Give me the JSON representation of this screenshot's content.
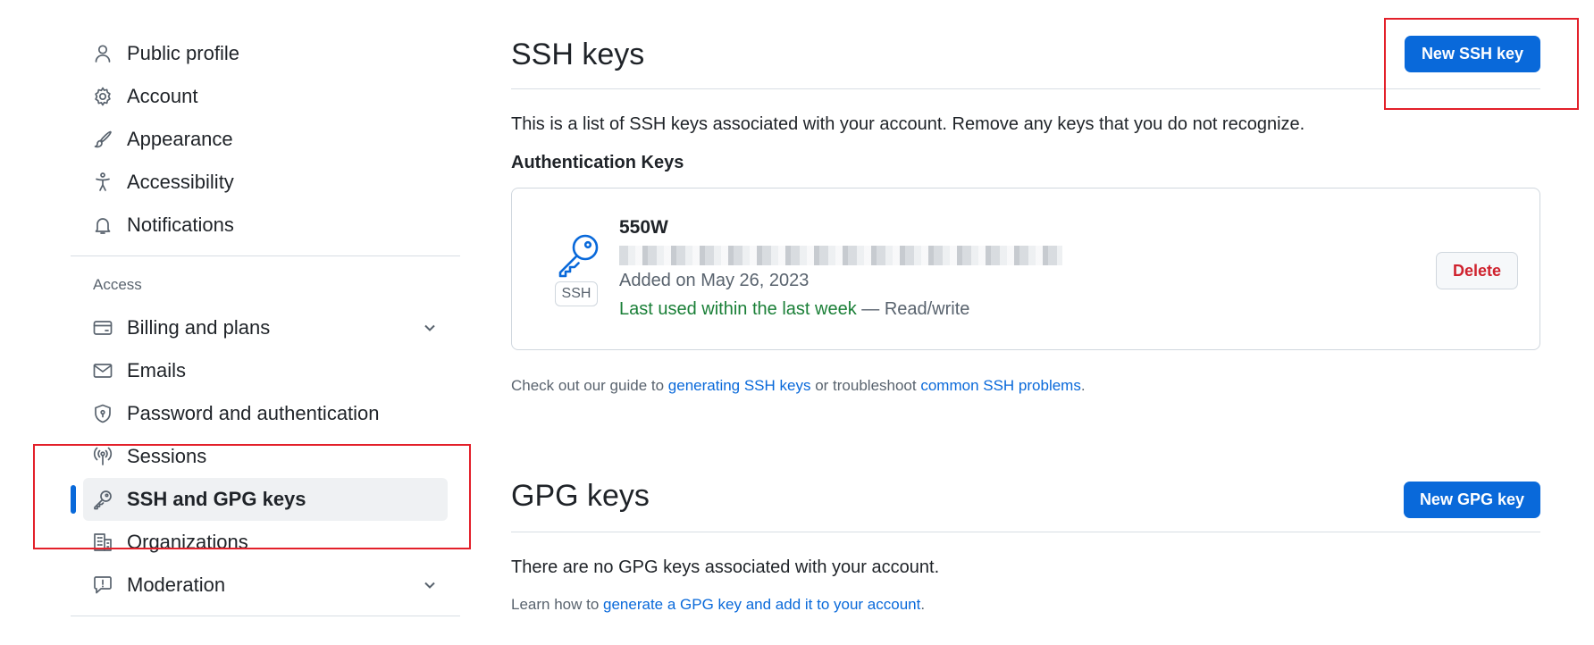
{
  "sidebar": {
    "items_top": [
      {
        "label": "Public profile",
        "icon": "person-icon"
      },
      {
        "label": "Account",
        "icon": "gear-icon"
      },
      {
        "label": "Appearance",
        "icon": "paintbrush-icon"
      },
      {
        "label": "Accessibility",
        "icon": "accessibility-icon"
      },
      {
        "label": "Notifications",
        "icon": "bell-icon"
      }
    ],
    "access_label": "Access",
    "items_access": [
      {
        "label": "Billing and plans",
        "icon": "credit-card-icon"
      },
      {
        "label": "Emails",
        "icon": "mail-icon"
      },
      {
        "label": "Password and authentication",
        "icon": "shield-lock-icon"
      },
      {
        "label": "Sessions",
        "icon": "broadcast-icon"
      },
      {
        "label": "SSH and GPG keys",
        "icon": "key-icon"
      },
      {
        "label": "Organizations",
        "icon": "organization-icon"
      },
      {
        "label": "Moderation",
        "icon": "report-icon"
      }
    ]
  },
  "ssh": {
    "title": "SSH keys",
    "new_button": "New SSH key",
    "description": "This is a list of SSH keys associated with your account. Remove any keys that you do not recognize.",
    "auth_heading": "Authentication Keys",
    "key": {
      "name": "550W",
      "badge": "SSH",
      "added": "Added on May 26, 2023",
      "last_used": "Last used within the last week",
      "access": " — Read/write",
      "delete_label": "Delete"
    },
    "guide": {
      "prefix": "Check out our guide to ",
      "link1": "generating SSH keys",
      "middle": " or troubleshoot ",
      "link2": "common SSH problems",
      "suffix": "."
    }
  },
  "gpg": {
    "title": "GPG keys",
    "new_button": "New GPG key",
    "empty": "There are no GPG keys associated with your account.",
    "learn_prefix": "Learn how to ",
    "learn_link": "generate a GPG key and add it to your account",
    "learn_suffix": "."
  },
  "colors": {
    "primary": "#0969da",
    "danger": "#cf222e",
    "success": "#1a7f37",
    "annotation": "#e3202a"
  }
}
